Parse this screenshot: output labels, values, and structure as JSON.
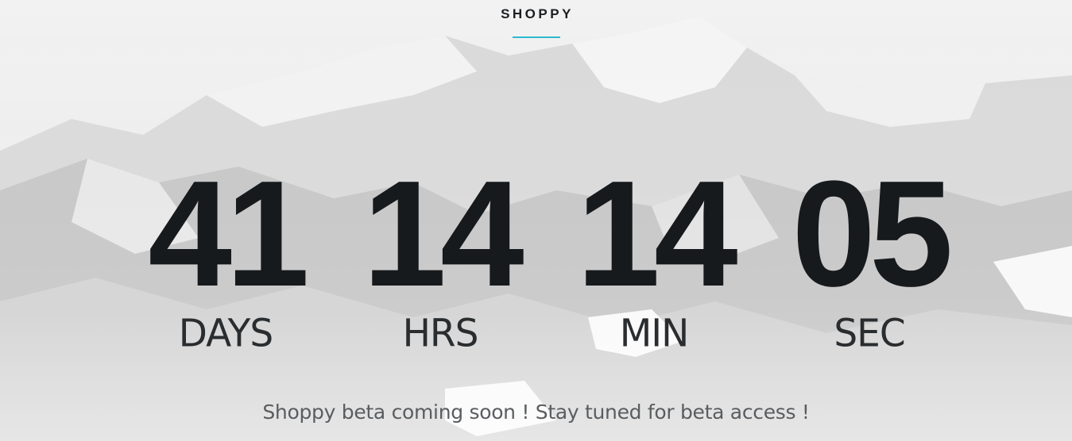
{
  "brand": {
    "name": "SHOPPY",
    "accent_color": "#29b9cf"
  },
  "countdown": {
    "days": {
      "value": "41",
      "label": "DAYS"
    },
    "hours": {
      "value": "14",
      "label": "HRS"
    },
    "minutes": {
      "value": "14",
      "label": "MIN"
    },
    "seconds": {
      "value": "05",
      "label": "SEC"
    }
  },
  "tagline": "Shoppy beta coming soon ! Stay tuned for beta access !",
  "background": {
    "description_icon": "snowy-mountain-image"
  }
}
